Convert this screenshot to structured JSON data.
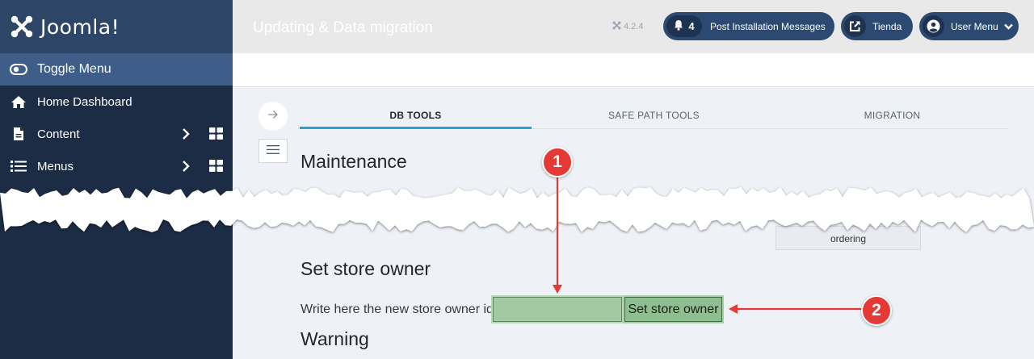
{
  "brand": {
    "name": "Joomla!"
  },
  "sidebar": {
    "toggle_label": "Toggle Menu",
    "items": [
      {
        "label": "Home Dashboard",
        "icon": "home-icon"
      },
      {
        "label": "Content",
        "icon": "file-icon"
      },
      {
        "label": "Menus",
        "icon": "list-icon"
      }
    ]
  },
  "header": {
    "title": "Updating & Data migration",
    "version": "4.2.4",
    "post_installation": {
      "count": "4",
      "label": "Post Installation Messages"
    },
    "store_label": "Tienda",
    "user_menu_label": "User Menu"
  },
  "tabs": [
    {
      "label": "DB TOOLS",
      "active": true
    },
    {
      "label": "SAFE PATH TOOLS",
      "active": false
    },
    {
      "label": "MIGRATION",
      "active": false
    }
  ],
  "main": {
    "maintenance_heading": "Maintenance",
    "ordering_fragment": "ordering",
    "set_store_owner_heading": "Set store owner",
    "owner_label": "Write here the new store owner id",
    "owner_input_value": "",
    "owner_button_label": "Set store owner",
    "warning_heading": "Warning"
  },
  "annotations": {
    "callout_1": "1",
    "callout_2": "2"
  },
  "colors": {
    "sidebar_bg": "#1c2c44",
    "brand_bg": "#2d4566",
    "toggle_bg": "#3e5e89",
    "header_button_bg": "#2c4a71",
    "tab_active_accent": "#2a9fd6",
    "highlight_green": "#a3c9a3",
    "callout_red": "#e53935"
  }
}
